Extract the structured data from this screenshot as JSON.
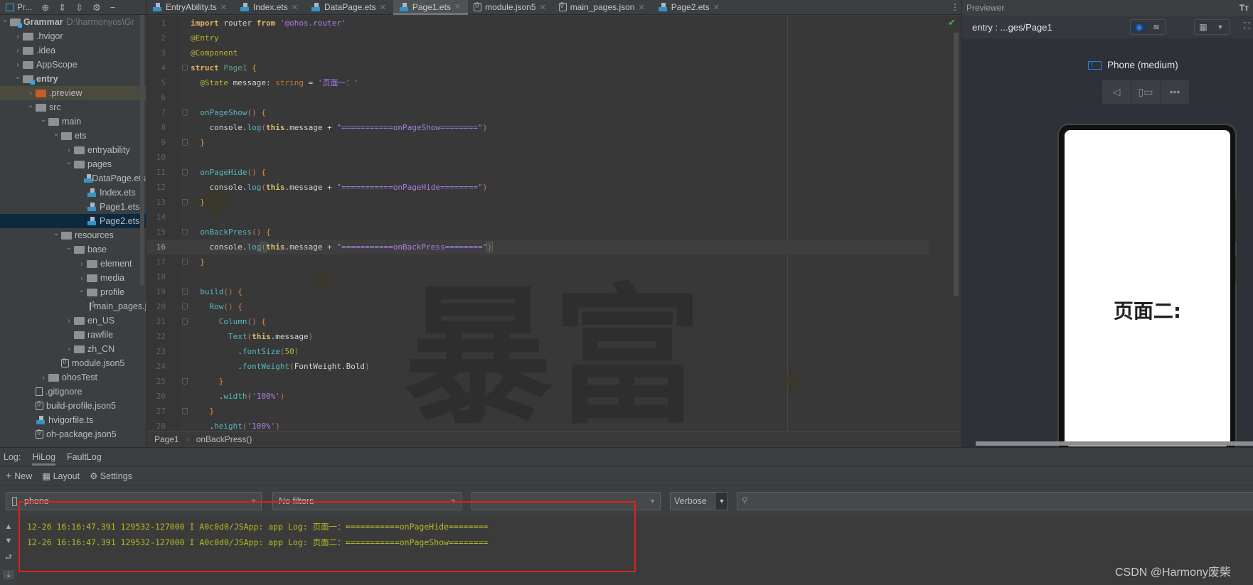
{
  "project_toolbar": {
    "label": "Pr..."
  },
  "tabs": [
    {
      "label": "EntryAbility.ts",
      "icon": "ts"
    },
    {
      "label": "Index.ets",
      "icon": "ets"
    },
    {
      "label": "DataPage.ets",
      "icon": "ets"
    },
    {
      "label": "Page1.ets",
      "icon": "ets",
      "active": true
    },
    {
      "label": "module.json5",
      "icon": "json"
    },
    {
      "label": "main_pages.json",
      "icon": "json"
    },
    {
      "label": "Page2.ets",
      "icon": "ets"
    }
  ],
  "tree": [
    {
      "d": 0,
      "a": "open",
      "i": "mod",
      "name": "Grammar",
      "bold": true,
      "path": "D:\\harmonyos\\Gr"
    },
    {
      "d": 1,
      "a": "closed",
      "i": "folder",
      "name": ".hvigor"
    },
    {
      "d": 1,
      "a": "closed",
      "i": "folder",
      "name": ".idea"
    },
    {
      "d": 1,
      "a": "closed",
      "i": "folder",
      "name": "AppScope"
    },
    {
      "d": 1,
      "a": "open",
      "i": "mod",
      "name": "entry",
      "bold": true
    },
    {
      "d": 2,
      "a": "closed",
      "i": "orange",
      "name": ".preview",
      "hl": true
    },
    {
      "d": 2,
      "a": "open",
      "i": "folder",
      "name": "src"
    },
    {
      "d": 3,
      "a": "open",
      "i": "folder",
      "name": "main"
    },
    {
      "d": 4,
      "a": "open",
      "i": "folder",
      "name": "ets"
    },
    {
      "d": 5,
      "a": "closed",
      "i": "folder",
      "name": "entryability"
    },
    {
      "d": 5,
      "a": "open",
      "i": "folder",
      "name": "pages"
    },
    {
      "d": 6,
      "a": "",
      "i": "ets",
      "name": "DataPage.ets"
    },
    {
      "d": 6,
      "a": "",
      "i": "ets",
      "name": "Index.ets"
    },
    {
      "d": 6,
      "a": "",
      "i": "ets",
      "name": "Page1.ets"
    },
    {
      "d": 6,
      "a": "",
      "i": "ets",
      "name": "Page2.ets",
      "sel": true
    },
    {
      "d": 4,
      "a": "open",
      "i": "folder",
      "name": "resources"
    },
    {
      "d": 5,
      "a": "open",
      "i": "folder",
      "name": "base"
    },
    {
      "d": 6,
      "a": "closed",
      "i": "folder",
      "name": "element"
    },
    {
      "d": 6,
      "a": "closed",
      "i": "folder",
      "name": "media"
    },
    {
      "d": 6,
      "a": "open",
      "i": "folder",
      "name": "profile"
    },
    {
      "d": 7,
      "a": "",
      "i": "json",
      "name": "main_pages.json"
    },
    {
      "d": 5,
      "a": "closed",
      "i": "folder",
      "name": "en_US"
    },
    {
      "d": 5,
      "a": "",
      "i": "folder",
      "name": "rawfile"
    },
    {
      "d": 5,
      "a": "closed",
      "i": "folder",
      "name": "zh_CN"
    },
    {
      "d": 4,
      "a": "",
      "i": "json",
      "name": "module.json5"
    },
    {
      "d": 3,
      "a": "closed",
      "i": "folder",
      "name": "ohosTest"
    },
    {
      "d": 2,
      "a": "",
      "i": "git",
      "name": ".gitignore"
    },
    {
      "d": 2,
      "a": "",
      "i": "json",
      "name": "build-profile.json5"
    },
    {
      "d": 2,
      "a": "",
      "i": "ts",
      "name": "hvigorfile.ts"
    },
    {
      "d": 2,
      "a": "",
      "i": "json",
      "name": "oh-package.json5"
    }
  ],
  "code": [
    {
      "f": 0,
      "t": [
        [
          "import",
          "kw"
        ],
        [
          " router "
        ],
        [
          "from",
          "kw"
        ],
        [
          " "
        ],
        [
          "'@ohos.router'",
          "st"
        ]
      ]
    },
    {
      "f": 0,
      "t": [
        [
          "@Entry",
          "an"
        ]
      ]
    },
    {
      "f": 0,
      "t": [
        [
          "@Component",
          "an"
        ]
      ]
    },
    {
      "f": 1,
      "t": [
        [
          "struct",
          "kw"
        ],
        [
          " "
        ],
        [
          "Page1",
          "cls"
        ],
        [
          " "
        ],
        [
          "{",
          "br"
        ]
      ]
    },
    {
      "f": 0,
      "t": [
        [
          "  "
        ],
        [
          "@State",
          "an"
        ],
        [
          " message: "
        ],
        [
          "string",
          "ty"
        ],
        [
          " = "
        ],
        [
          "'页面一：'",
          "st"
        ]
      ]
    },
    {
      "f": 0,
      "t": []
    },
    {
      "f": 1,
      "t": [
        [
          "  "
        ],
        [
          "onPageShow",
          "fn"
        ],
        [
          "()",
          "pa"
        ],
        [
          " "
        ],
        [
          "{",
          "br"
        ]
      ]
    },
    {
      "f": 0,
      "t": [
        [
          "    console."
        ],
        [
          "log",
          "fn"
        ],
        [
          "(",
          "pa"
        ],
        [
          "this",
          "th"
        ],
        [
          ".message + "
        ],
        [
          "\"===========onPageShow========\"",
          "st"
        ],
        [
          ")",
          "pa"
        ]
      ]
    },
    {
      "f": 1,
      "t": [
        [
          "  "
        ],
        [
          "}",
          "br"
        ]
      ]
    },
    {
      "f": 0,
      "t": []
    },
    {
      "f": 1,
      "t": [
        [
          "  "
        ],
        [
          "onPageHide",
          "fn"
        ],
        [
          "()",
          "pa"
        ],
        [
          " "
        ],
        [
          "{",
          "br"
        ]
      ]
    },
    {
      "f": 0,
      "t": [
        [
          "    console."
        ],
        [
          "log",
          "fn"
        ],
        [
          "(",
          "pa"
        ],
        [
          "this",
          "th"
        ],
        [
          ".message + "
        ],
        [
          "\"===========onPageHide========\"",
          "st"
        ],
        [
          ")",
          "pa"
        ]
      ]
    },
    {
      "f": 1,
      "t": [
        [
          "  "
        ],
        [
          "}",
          "br"
        ]
      ]
    },
    {
      "f": 0,
      "t": []
    },
    {
      "f": 1,
      "t": [
        [
          "  "
        ],
        [
          "onBackPress",
          "fn"
        ],
        [
          "()",
          "pa"
        ],
        [
          " "
        ],
        [
          "{",
          "br"
        ]
      ]
    },
    {
      "f": 0,
      "cur": true,
      "t": [
        [
          "    console."
        ],
        [
          "log",
          "fn"
        ],
        [
          "(",
          "pa mark"
        ],
        [
          "this",
          "th"
        ],
        [
          ".message + "
        ],
        [
          "\"===========onBackPress========\"",
          "st"
        ],
        [
          ")",
          "pa mark"
        ]
      ]
    },
    {
      "f": 1,
      "t": [
        [
          "  "
        ],
        [
          "}",
          "br"
        ]
      ]
    },
    {
      "f": 0,
      "t": []
    },
    {
      "f": 1,
      "t": [
        [
          "  "
        ],
        [
          "build",
          "fn"
        ],
        [
          "()",
          "pa"
        ],
        [
          " "
        ],
        [
          "{",
          "br"
        ]
      ]
    },
    {
      "f": 1,
      "t": [
        [
          "    "
        ],
        [
          "Row",
          "fn"
        ],
        [
          "()",
          "pa"
        ],
        [
          " "
        ],
        [
          "{",
          "br"
        ]
      ]
    },
    {
      "f": 1,
      "t": [
        [
          "      "
        ],
        [
          "Column",
          "fn"
        ],
        [
          "()",
          "pa"
        ],
        [
          " "
        ],
        [
          "{",
          "br"
        ]
      ]
    },
    {
      "f": 0,
      "t": [
        [
          "        "
        ],
        [
          "Text",
          "fn"
        ],
        [
          "(",
          "pa"
        ],
        [
          "this",
          "th"
        ],
        [
          ".message"
        ],
        [
          ")",
          "pa"
        ]
      ]
    },
    {
      "f": 0,
      "t": [
        [
          "          ."
        ],
        [
          "fontSize",
          "fn"
        ],
        [
          "(",
          "pa"
        ],
        [
          "50",
          "nu"
        ],
        [
          ")",
          "pa"
        ]
      ]
    },
    {
      "f": 0,
      "t": [
        [
          "          ."
        ],
        [
          "fontWeight",
          "fn"
        ],
        [
          "(",
          "pa"
        ],
        [
          "FontWeight.Bold"
        ],
        [
          ")",
          "pa"
        ]
      ]
    },
    {
      "f": 1,
      "t": [
        [
          "      "
        ],
        [
          "}",
          "br"
        ]
      ]
    },
    {
      "f": 0,
      "t": [
        [
          "      ."
        ],
        [
          "width",
          "fn"
        ],
        [
          "(",
          "pa"
        ],
        [
          "'100%'",
          "st"
        ],
        [
          ")",
          "pa"
        ]
      ]
    },
    {
      "f": 1,
      "t": [
        [
          "    "
        ],
        [
          "}",
          "br"
        ]
      ]
    },
    {
      "f": 0,
      "t": [
        [
          "    ."
        ],
        [
          "height",
          "fn"
        ],
        [
          "(",
          "pa"
        ],
        [
          "'100%'",
          "st"
        ],
        [
          ")",
          "pa"
        ]
      ]
    }
  ],
  "breadcrumb": [
    "Page1",
    "onBackPress()"
  ],
  "previewer": {
    "title": "Previewer",
    "path": "entry : ...ges/Page1",
    "device": "Phone (medium)",
    "page_text": "页面二:"
  },
  "log": {
    "label": "Log:",
    "tabs": [
      "HiLog",
      "FaultLog"
    ],
    "active_tab": "HiLog",
    "toolbar": {
      "new": "New",
      "layout": "Layout",
      "settings": "Settings"
    },
    "device_select": "phone",
    "filter_select": "No filters",
    "process_select": "",
    "level_select": "Verbose",
    "search_placeholder": "",
    "lines": [
      "12-26 16:16:47.391 129532-127000 I A0c0d0/JSApp: app Log: 页面一：===========onPageHide========",
      "12-26 16:16:47.391 129532-127000 I A0c0d0/JSApp: app Log: 页面二：===========onPageShow========"
    ]
  },
  "watermark": "CSDN @Harmony废柴",
  "colors": {
    "accent": "#2a7fe4",
    "log_text": "#b4bb1f",
    "highlight_box": "#e02020",
    "ok": "#4caf50"
  }
}
